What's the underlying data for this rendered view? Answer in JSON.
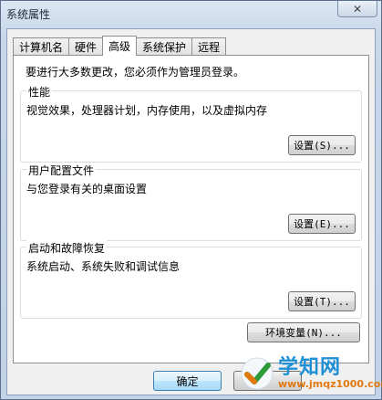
{
  "window": {
    "title": "系统属性",
    "close_glyph": "✕"
  },
  "tabs": [
    {
      "label": "计算机名",
      "active": false
    },
    {
      "label": "硬件",
      "active": false
    },
    {
      "label": "高级",
      "active": true
    },
    {
      "label": "系统保护",
      "active": false
    },
    {
      "label": "远程",
      "active": false
    }
  ],
  "notice": "要进行大多数更改，您必须作为管理员登录。",
  "groups": {
    "performance": {
      "title": "性能",
      "desc": "视觉效果，处理器计划，内存使用，以及虚拟内存",
      "button": "设置(S)..."
    },
    "profiles": {
      "title": "用户配置文件",
      "desc": "与您登录有关的桌面设置",
      "button": "设置(E)..."
    },
    "startup": {
      "title": "启动和故障恢复",
      "desc": "系统启动、系统失败和调试信息",
      "button": "设置(T)..."
    }
  },
  "env_button": "环境变量(N)...",
  "footer": {
    "ok": "确定"
  },
  "watermark": {
    "brand": "学知网",
    "url": "www.jmqz1000.com"
  }
}
